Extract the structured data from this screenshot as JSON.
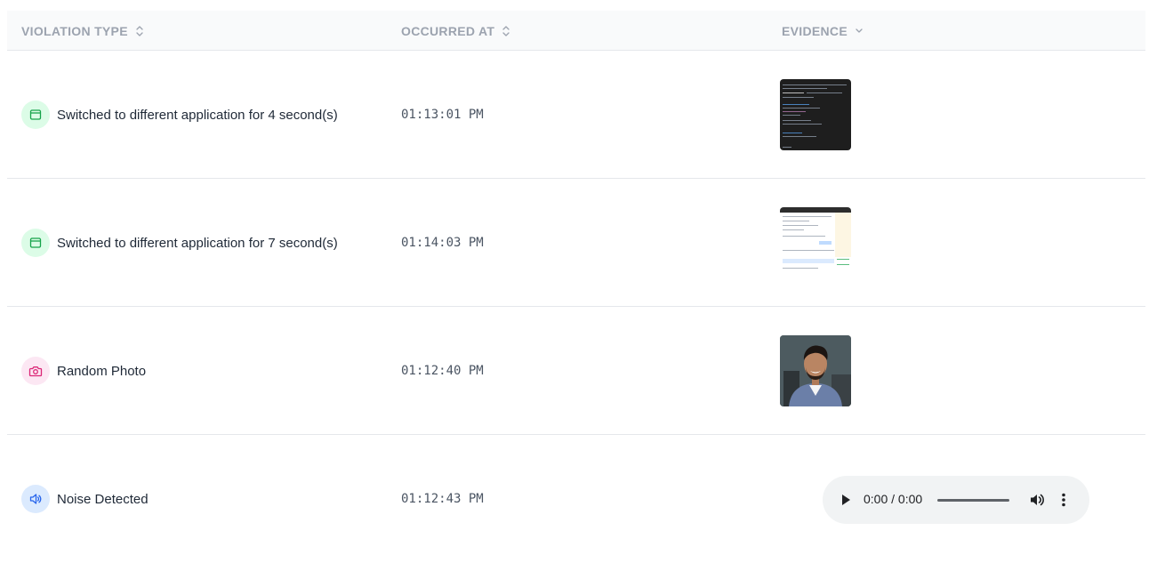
{
  "header": {
    "violation_type": "VIOLATION TYPE",
    "occurred_at": "OCCURRED AT",
    "evidence": "EVIDENCE"
  },
  "rows": [
    {
      "type_label": "Switched to different application for 4 second(s)",
      "time": "01:13:01 PM",
      "icon": "app-window-icon",
      "evidence": "screenshot-code-editor"
    },
    {
      "type_label": "Switched to different application for 7 second(s)",
      "time": "01:14:03 PM",
      "icon": "app-window-icon",
      "evidence": "screenshot-document"
    },
    {
      "type_label": "Random Photo",
      "time": "01:12:40 PM",
      "icon": "camera-icon",
      "evidence": "photo-person"
    },
    {
      "type_label": "Noise Detected",
      "time": "01:12:43 PM",
      "icon": "speaker-icon",
      "evidence": "audio-player"
    }
  ],
  "audio": {
    "time_display": "0:00 / 0:00"
  },
  "colors": {
    "green_icon": "#16a34a",
    "pink_icon": "#db2777",
    "blue_icon": "#2563eb",
    "header_text": "#9ca3af"
  }
}
